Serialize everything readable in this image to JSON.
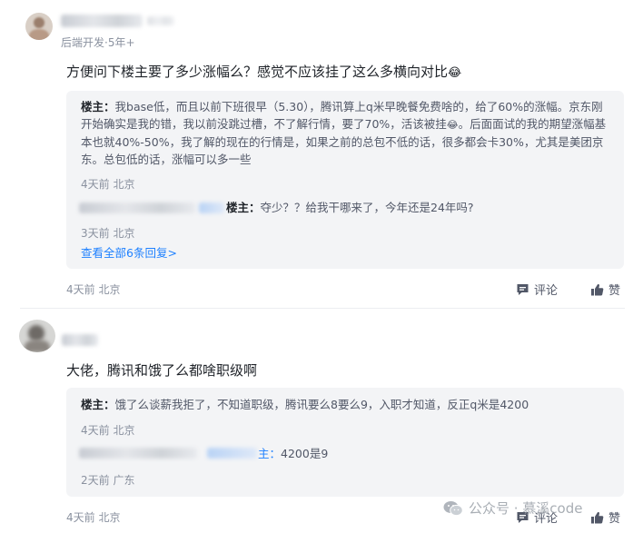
{
  "comment1": {
    "author_meta": "后端开发·5年+",
    "text": "方便问下楼主要了多少涨幅么？感觉不应该挂了这么多横向对比",
    "emoji": "😂",
    "reply1": {
      "author": "楼主：",
      "text": "我base低，而且以前下班很早（5.30），腾讯算上q米早晚餐免费啥的，给了60%的涨幅。京东刚开始确实是我的错，我以前没跳过槽，不了解行情，要了70%，活该被挂",
      "emoji": "😂",
      "text2": "。后面面试的我的期望涨幅基本也就40%-50%，我了解的现在的行情是，如果之前的总包不低的话，很多都会卡30%，尤其是美团京东。总包低的话，涨幅可以多一些",
      "meta": "4天前 北京"
    },
    "reply2": {
      "to": "楼主：",
      "text": "夺少？？给我干哪来了，今年还是24年吗?",
      "meta": "3天前 北京"
    },
    "view_all": "查看全部6条回复>",
    "meta": "4天前 北京",
    "comment_label": "评论",
    "like_label": "赞"
  },
  "comment2": {
    "text": "大佬，腾讯和饿了么都啥职级啊",
    "reply1": {
      "author": "楼主：",
      "text": "饿了么谈薪我拒了，不知道职级，腾讯要么8要么9，入职才知道，反正q米是4200",
      "meta": "4天前 北京"
    },
    "reply2": {
      "to": "主：",
      "text": "4200是9",
      "meta": "2天前 广东"
    },
    "meta": "4天前 北京",
    "comment_label": "评论",
    "like_label": "赞"
  },
  "watermark": "公众号 · 慕溪code",
  "icons": [
    "comment-icon",
    "like-icon",
    "wechat-icon"
  ]
}
